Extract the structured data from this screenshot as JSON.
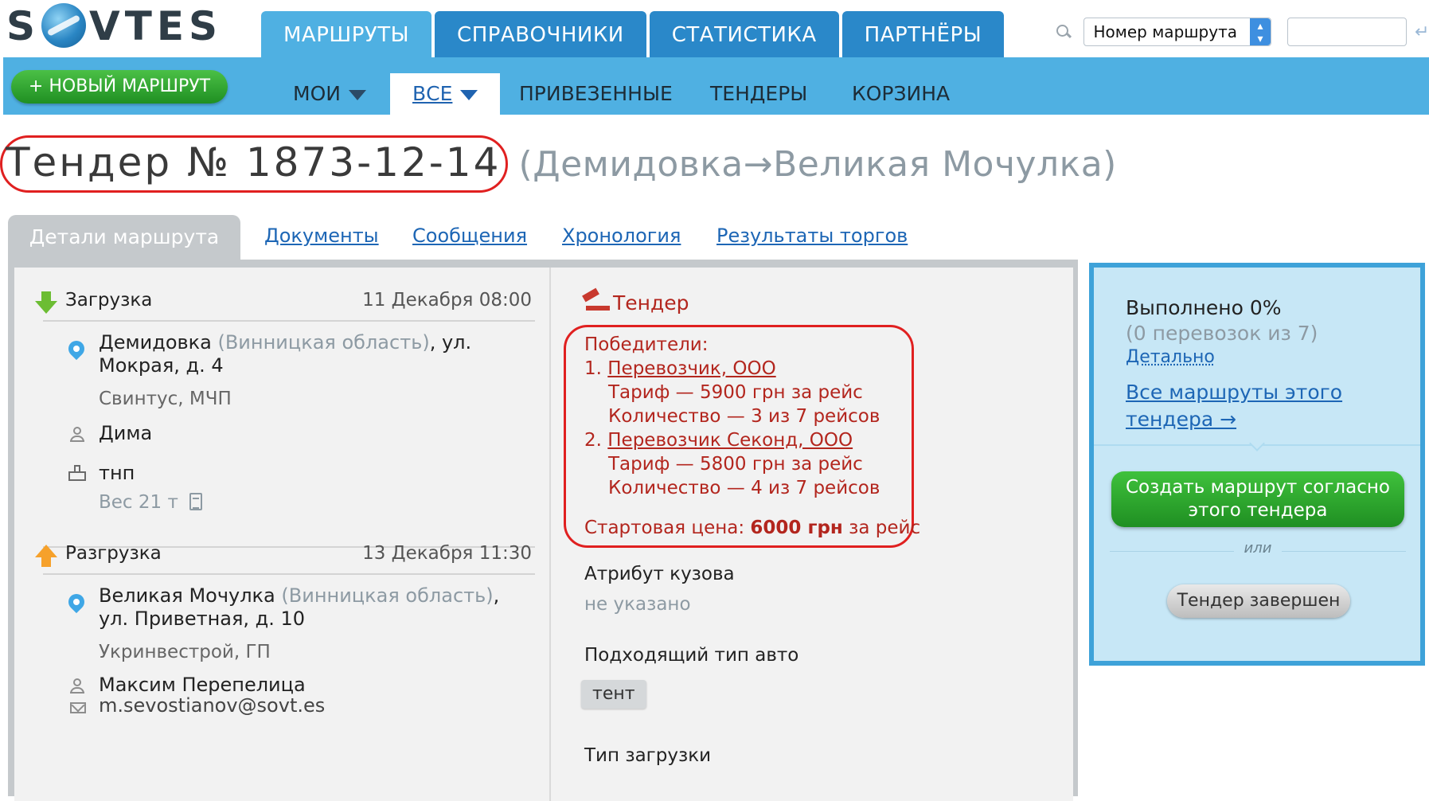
{
  "header": {
    "logo_text_left": "S",
    "logo_text_right": "VTES",
    "tabs": [
      "МАРШРУТЫ",
      "СПРАВОЧНИКИ",
      "СТАТИСТИКА",
      "ПАРТНЁРЫ"
    ],
    "search_select": "Номер маршрута",
    "search_value": ""
  },
  "subnav": {
    "new_route": "+ НОВЫЙ МАРШРУТ",
    "items": [
      "МОИ",
      "ВСЕ",
      "ПРИВЕЗЕННЫЕ",
      "ТЕНДЕРЫ",
      "КОРЗИНА"
    ]
  },
  "title": {
    "tender": "Тендер № 1873-12-14",
    "route": "(Демидовка→Великая Мочулка)"
  },
  "detail_tabs": {
    "active": "Детали маршрута",
    "links": [
      "Документы",
      "Сообщения",
      "Хронология",
      "Результаты торгов"
    ]
  },
  "loading": {
    "label": "Загрузка",
    "date": "11 Декабря 08:00",
    "city": "Демидовка",
    "region": " (Винницкая область)",
    "address": ", ул. Мокрая, д. 4",
    "company": "Свинтус, МЧП",
    "contact": "Дима",
    "cargo": "тнп",
    "weight": "Вес 21 т"
  },
  "unloading": {
    "label": "Разгрузка",
    "date": "13 Декабря 11:30",
    "city": "Великая Мочулка",
    "region": " (Винницкая область)",
    "address": ", ул. Приветная, д. 10",
    "company": "Укринвестрой, ГП",
    "contact": "Максим Перепелица",
    "email": "m.sevostianov@sovt.es"
  },
  "tender": {
    "label": "Тендер",
    "winners_title": "Победители:",
    "winners": [
      {
        "num": "1. ",
        "name": "Перевозчик, ООО",
        "tariff": "Тариф — 5900 грн за рейс",
        "qty": "Количество — 3 из 7 рейсов"
      },
      {
        "num": "2. ",
        "name": "Перевозчик Секонд, ООО",
        "tariff": "Тариф — 5800 грн за рейс",
        "qty": "Количество — 4 из 7 рейсов"
      }
    ],
    "start_price_label": "Стартовая цена: ",
    "start_price_value": "6000 грн",
    "start_price_suffix": " за рейс",
    "body_attr_label": "Атрибут кузова",
    "body_attr_value": "не указано",
    "vehicle_label": "Подходящий тип авто",
    "vehicle_value": "тент",
    "loading_type_label": "Тип загрузки"
  },
  "sidebar": {
    "done": "Выполнено 0%",
    "count": "(0 перевозок из 7)",
    "detail": "Детально",
    "all_routes": "Все маршруты этого тендера →",
    "create": "Создать маршрут согласно этого тендера",
    "or": "или",
    "finished": "Тендер завершен"
  }
}
